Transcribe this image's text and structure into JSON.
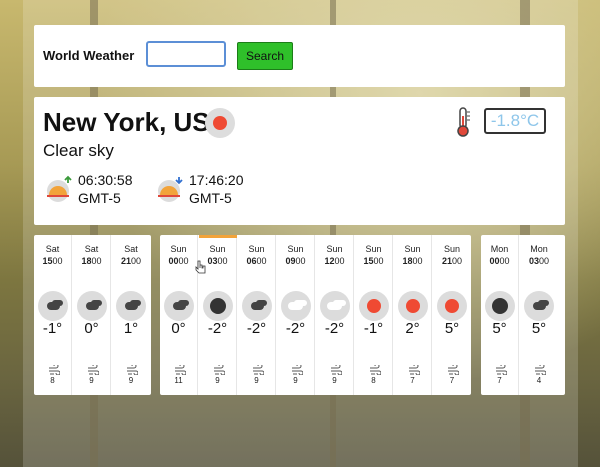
{
  "header": {
    "brand": "World Weather",
    "search_value": "",
    "search_button": "Search"
  },
  "current": {
    "city": "New York, US",
    "condition_icon": "sun-icon",
    "description": "Clear sky",
    "temperature": "-1.8°C",
    "sunrise": {
      "time": "06:30:58",
      "tz": "GMT-5"
    },
    "sunset": {
      "time": "17:46:20",
      "tz": "GMT-5"
    }
  },
  "forecast_groups": [
    {
      "slots": [
        {
          "day": "Sat",
          "hour": "15",
          "min": "00",
          "icon": "cloud-icon",
          "temp": "-1°",
          "wind": "8"
        },
        {
          "day": "Sat",
          "hour": "18",
          "min": "00",
          "icon": "cloud-icon",
          "temp": "0°",
          "wind": "9"
        },
        {
          "day": "Sat",
          "hour": "21",
          "min": "00",
          "icon": "cloud-icon",
          "temp": "1°",
          "wind": "9"
        }
      ]
    },
    {
      "slots": [
        {
          "day": "Sun",
          "hour": "00",
          "min": "00",
          "icon": "cloud-icon",
          "temp": "0°",
          "wind": "11"
        },
        {
          "day": "Sun",
          "hour": "03",
          "min": "00",
          "icon": "moon-icon",
          "temp": "-2°",
          "wind": "9"
        },
        {
          "day": "Sun",
          "hour": "06",
          "min": "00",
          "icon": "cloud-icon",
          "temp": "-2°",
          "wind": "9"
        },
        {
          "day": "Sun",
          "hour": "09",
          "min": "00",
          "icon": "cloudy-icon",
          "temp": "-2°",
          "wind": "9"
        },
        {
          "day": "Sun",
          "hour": "12",
          "min": "00",
          "icon": "cloudy-icon",
          "temp": "-2°",
          "wind": "9"
        },
        {
          "day": "Sun",
          "hour": "15",
          "min": "00",
          "icon": "sun-icon",
          "temp": "-1°",
          "wind": "8"
        },
        {
          "day": "Sun",
          "hour": "18",
          "min": "00",
          "icon": "sun-icon",
          "temp": "2°",
          "wind": "7"
        },
        {
          "day": "Sun",
          "hour": "21",
          "min": "00",
          "icon": "sun-icon",
          "temp": "5°",
          "wind": "7"
        }
      ]
    },
    {
      "slots": [
        {
          "day": "Mon",
          "hour": "00",
          "min": "00",
          "icon": "moon-icon",
          "temp": "5°",
          "wind": "7"
        },
        {
          "day": "Mon",
          "hour": "03",
          "min": "00",
          "icon": "cloud-icon",
          "temp": "5°",
          "wind": "4"
        }
      ]
    }
  ],
  "colors": {
    "search_button": "#2fc02a",
    "sun": "#ef4a33",
    "temp_text": "#8ec6ea",
    "active_indicator": "#f2a33a"
  }
}
